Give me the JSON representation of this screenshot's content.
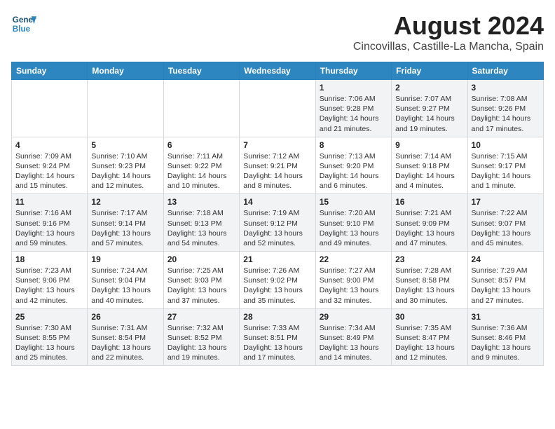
{
  "header": {
    "logo_line1": "General",
    "logo_line2": "Blue",
    "month_title": "August 2024",
    "location": "Cincovillas, Castille-La Mancha, Spain"
  },
  "days_of_week": [
    "Sunday",
    "Monday",
    "Tuesday",
    "Wednesday",
    "Thursday",
    "Friday",
    "Saturday"
  ],
  "weeks": [
    [
      {
        "day": "",
        "info": ""
      },
      {
        "day": "",
        "info": ""
      },
      {
        "day": "",
        "info": ""
      },
      {
        "day": "",
        "info": ""
      },
      {
        "day": "1",
        "info": "Sunrise: 7:06 AM\nSunset: 9:28 PM\nDaylight: 14 hours\nand 21 minutes."
      },
      {
        "day": "2",
        "info": "Sunrise: 7:07 AM\nSunset: 9:27 PM\nDaylight: 14 hours\nand 19 minutes."
      },
      {
        "day": "3",
        "info": "Sunrise: 7:08 AM\nSunset: 9:26 PM\nDaylight: 14 hours\nand 17 minutes."
      }
    ],
    [
      {
        "day": "4",
        "info": "Sunrise: 7:09 AM\nSunset: 9:24 PM\nDaylight: 14 hours\nand 15 minutes."
      },
      {
        "day": "5",
        "info": "Sunrise: 7:10 AM\nSunset: 9:23 PM\nDaylight: 14 hours\nand 12 minutes."
      },
      {
        "day": "6",
        "info": "Sunrise: 7:11 AM\nSunset: 9:22 PM\nDaylight: 14 hours\nand 10 minutes."
      },
      {
        "day": "7",
        "info": "Sunrise: 7:12 AM\nSunset: 9:21 PM\nDaylight: 14 hours\nand 8 minutes."
      },
      {
        "day": "8",
        "info": "Sunrise: 7:13 AM\nSunset: 9:20 PM\nDaylight: 14 hours\nand 6 minutes."
      },
      {
        "day": "9",
        "info": "Sunrise: 7:14 AM\nSunset: 9:18 PM\nDaylight: 14 hours\nand 4 minutes."
      },
      {
        "day": "10",
        "info": "Sunrise: 7:15 AM\nSunset: 9:17 PM\nDaylight: 14 hours\nand 1 minute."
      }
    ],
    [
      {
        "day": "11",
        "info": "Sunrise: 7:16 AM\nSunset: 9:16 PM\nDaylight: 13 hours\nand 59 minutes."
      },
      {
        "day": "12",
        "info": "Sunrise: 7:17 AM\nSunset: 9:14 PM\nDaylight: 13 hours\nand 57 minutes."
      },
      {
        "day": "13",
        "info": "Sunrise: 7:18 AM\nSunset: 9:13 PM\nDaylight: 13 hours\nand 54 minutes."
      },
      {
        "day": "14",
        "info": "Sunrise: 7:19 AM\nSunset: 9:12 PM\nDaylight: 13 hours\nand 52 minutes."
      },
      {
        "day": "15",
        "info": "Sunrise: 7:20 AM\nSunset: 9:10 PM\nDaylight: 13 hours\nand 49 minutes."
      },
      {
        "day": "16",
        "info": "Sunrise: 7:21 AM\nSunset: 9:09 PM\nDaylight: 13 hours\nand 47 minutes."
      },
      {
        "day": "17",
        "info": "Sunrise: 7:22 AM\nSunset: 9:07 PM\nDaylight: 13 hours\nand 45 minutes."
      }
    ],
    [
      {
        "day": "18",
        "info": "Sunrise: 7:23 AM\nSunset: 9:06 PM\nDaylight: 13 hours\nand 42 minutes."
      },
      {
        "day": "19",
        "info": "Sunrise: 7:24 AM\nSunset: 9:04 PM\nDaylight: 13 hours\nand 40 minutes."
      },
      {
        "day": "20",
        "info": "Sunrise: 7:25 AM\nSunset: 9:03 PM\nDaylight: 13 hours\nand 37 minutes."
      },
      {
        "day": "21",
        "info": "Sunrise: 7:26 AM\nSunset: 9:02 PM\nDaylight: 13 hours\nand 35 minutes."
      },
      {
        "day": "22",
        "info": "Sunrise: 7:27 AM\nSunset: 9:00 PM\nDaylight: 13 hours\nand 32 minutes."
      },
      {
        "day": "23",
        "info": "Sunrise: 7:28 AM\nSunset: 8:58 PM\nDaylight: 13 hours\nand 30 minutes."
      },
      {
        "day": "24",
        "info": "Sunrise: 7:29 AM\nSunset: 8:57 PM\nDaylight: 13 hours\nand 27 minutes."
      }
    ],
    [
      {
        "day": "25",
        "info": "Sunrise: 7:30 AM\nSunset: 8:55 PM\nDaylight: 13 hours\nand 25 minutes."
      },
      {
        "day": "26",
        "info": "Sunrise: 7:31 AM\nSunset: 8:54 PM\nDaylight: 13 hours\nand 22 minutes."
      },
      {
        "day": "27",
        "info": "Sunrise: 7:32 AM\nSunset: 8:52 PM\nDaylight: 13 hours\nand 19 minutes."
      },
      {
        "day": "28",
        "info": "Sunrise: 7:33 AM\nSunset: 8:51 PM\nDaylight: 13 hours\nand 17 minutes."
      },
      {
        "day": "29",
        "info": "Sunrise: 7:34 AM\nSunset: 8:49 PM\nDaylight: 13 hours\nand 14 minutes."
      },
      {
        "day": "30",
        "info": "Sunrise: 7:35 AM\nSunset: 8:47 PM\nDaylight: 13 hours\nand 12 minutes."
      },
      {
        "day": "31",
        "info": "Sunrise: 7:36 AM\nSunset: 8:46 PM\nDaylight: 13 hours\nand 9 minutes."
      }
    ]
  ]
}
